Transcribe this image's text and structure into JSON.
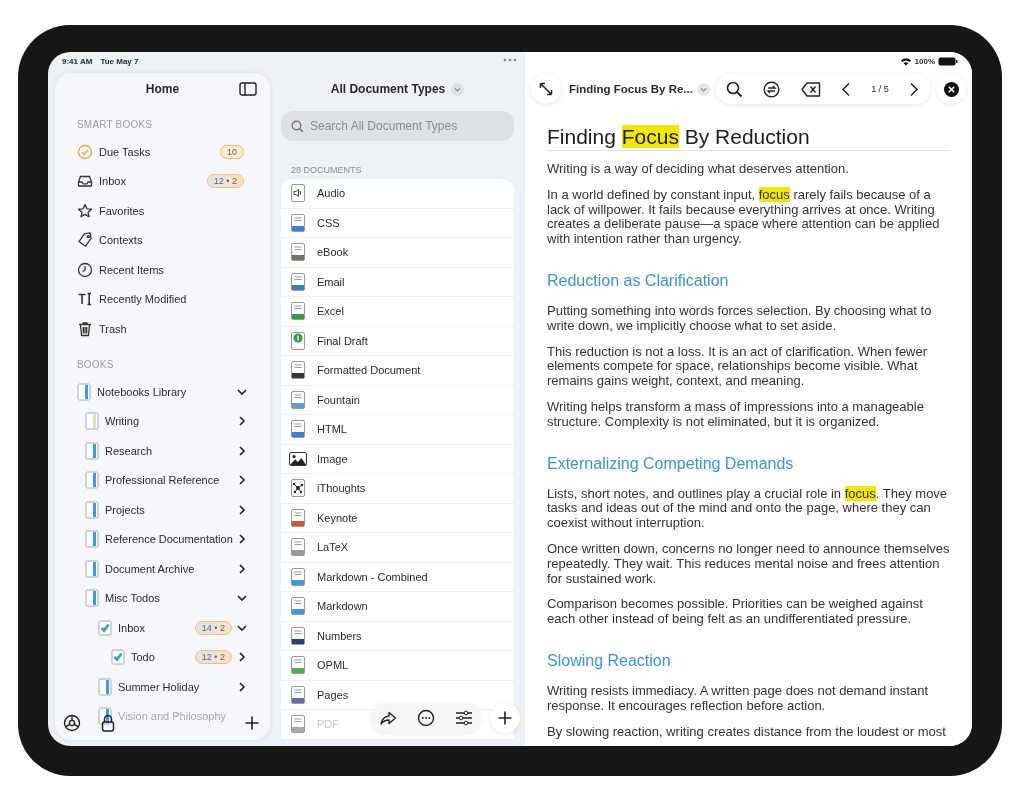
{
  "status_bar": {
    "time": "9:41 AM",
    "date": "Tue May 7",
    "battery": "100%"
  },
  "sidebar": {
    "title": "Home",
    "smart_books_label": "SMART BOOKS",
    "smart_books": [
      {
        "label": "Due Tasks",
        "kind": "check",
        "badge": {
          "text": "10",
          "kind": "due"
        }
      },
      {
        "label": "Inbox",
        "kind": "inbox",
        "badge": {
          "text": "12 • 2",
          "kind": "split"
        }
      },
      {
        "label": "Favorites",
        "kind": "star"
      },
      {
        "label": "Contexts",
        "kind": "tag"
      },
      {
        "label": "Recent Items",
        "kind": "clock"
      },
      {
        "label": "Recently Modified",
        "kind": "text"
      },
      {
        "label": "Trash",
        "kind": "trash"
      }
    ],
    "books_label": "BOOKS",
    "books": [
      {
        "label": "Notebooks Library",
        "kind": "notebook",
        "color": "#3b9be8",
        "expanded": true,
        "children": [
          {
            "label": "Writing",
            "kind": "notebook",
            "color": "#e8dcb0",
            "expanded": false
          },
          {
            "label": "Research",
            "kind": "notebook",
            "color": "#3b9be8",
            "expanded": false
          },
          {
            "label": "Professional Reference",
            "kind": "notebook",
            "color": "#3b9be8",
            "expanded": false
          },
          {
            "label": "Projects",
            "kind": "notebook",
            "color": "#3b9be8",
            "expanded": false
          },
          {
            "label": "Reference Documentation",
            "kind": "notebook",
            "color": "#3b9be8",
            "expanded": false
          },
          {
            "label": "Document Archive",
            "kind": "notebook",
            "color": "#3b9be8",
            "expanded": false
          },
          {
            "label": "Misc Todos",
            "kind": "notebook",
            "color": "#3b9be8",
            "expanded": true,
            "children": [
              {
                "label": "Inbox",
                "kind": "checklist",
                "color": "#3b9be8",
                "expanded": true,
                "badge": {
                  "text": "14 • 2",
                  "kind": "split"
                },
                "children": [
                  {
                    "label": "Todo",
                    "kind": "checklist",
                    "color": "#3b9be8",
                    "expanded": false,
                    "badge": {
                      "text": "12 • 2",
                      "kind": "split"
                    }
                  }
                ]
              },
              {
                "label": "Summer Holiday",
                "kind": "notebook",
                "color": "#3b9be8",
                "expanded": false
              },
              {
                "label": "Vision and Philosophy",
                "kind": "notebook",
                "color": "#3b9be8",
                "dimmed": true
              }
            ]
          }
        ]
      }
    ]
  },
  "document_list": {
    "title": "All Document Types",
    "search": {
      "placeholder": "Search All Document Types"
    },
    "count": "28 DOCUMENTS",
    "items": [
      {
        "label": "Audio",
        "kind": "audio"
      },
      {
        "label": "CSS",
        "kind": "doc",
        "color": "#3b82d6"
      },
      {
        "label": "eBook",
        "kind": "doc",
        "color": "#7a6f6a"
      },
      {
        "label": "Email",
        "kind": "doc",
        "color": "#3f7cc0"
      },
      {
        "label": "Excel",
        "kind": "doc",
        "color": "#3a9a4a"
      },
      {
        "label": "Final Draft",
        "kind": "draft"
      },
      {
        "label": "Formatted Document",
        "kind": "doc",
        "color": "#333333"
      },
      {
        "label": "Fountain",
        "kind": "doc",
        "color": "#5aa0d0"
      },
      {
        "label": "HTML",
        "kind": "doc",
        "color": "#3b82d6"
      },
      {
        "label": "Image",
        "kind": "image"
      },
      {
        "label": "iThoughts",
        "kind": "mindmap"
      },
      {
        "label": "Keynote",
        "kind": "doc",
        "color": "#c0602a"
      },
      {
        "label": "LaTeX",
        "kind": "doc",
        "color": "#9a9a9a"
      },
      {
        "label": "Markdown - Combined",
        "kind": "doc",
        "color": "#3b9be0"
      },
      {
        "label": "Markdown",
        "kind": "doc",
        "color": "#3b9be0"
      },
      {
        "label": "Numbers",
        "kind": "doc",
        "color": "#2c3e70"
      },
      {
        "label": "OPML",
        "kind": "doc",
        "color": "#4caf50"
      },
      {
        "label": "Pages",
        "kind": "doc",
        "color": "#6a6aa8"
      },
      {
        "label": "PDF",
        "kind": "doc",
        "color": "#aaaaaa",
        "dimmed": true
      }
    ]
  },
  "editor": {
    "title": "Finding Focus By Re...",
    "find_position": "1 / 5"
  },
  "document": {
    "title": [
      {
        "text": "Finding ",
        "highlighted": false
      },
      {
        "text": "Focus",
        "highlighted": true
      },
      {
        "text": " By Reduction",
        "highlighted": false
      }
    ],
    "blocks": [
      {
        "kind": "paragraph",
        "segments": [
          {
            "text": "Writing is a way of deciding what deserves attention.",
            "highlighted": false
          }
        ]
      },
      {
        "kind": "paragraph",
        "segments": [
          {
            "text": "In a world defined by constant input, ",
            "highlighted": false
          },
          {
            "text": "focus",
            "highlighted": true
          },
          {
            "text": " rarely fails because of a lack of willpower. It fails because everything arrives at once. Writing creates a deliberate pause—a space where attention can be applied with intention rather than urgency.",
            "highlighted": false
          }
        ]
      },
      {
        "kind": "heading",
        "segments": [
          {
            "text": "Reduction as Clarification",
            "highlighted": false
          }
        ]
      },
      {
        "kind": "paragraph",
        "segments": [
          {
            "text": "Putting something into words forces selection. By choosing what to write down, we implicitly choose what to set aside.",
            "highlighted": false
          }
        ]
      },
      {
        "kind": "paragraph",
        "segments": [
          {
            "text": "This reduction is not a loss. It is an act of clarification. When fewer elements compete for space, relationships become visible. What remains gains weight, context, and meaning.",
            "highlighted": false
          }
        ]
      },
      {
        "kind": "paragraph",
        "segments": [
          {
            "text": "Writing helps transform a mass of impressions into a manageable structure. Complexity is not eliminated, but it is organized.",
            "highlighted": false
          }
        ]
      },
      {
        "kind": "heading",
        "segments": [
          {
            "text": "Externalizing Competing Demands",
            "highlighted": false
          }
        ]
      },
      {
        "kind": "paragraph",
        "segments": [
          {
            "text": "Lists, short notes, and outlines play a crucial role in ",
            "highlighted": false
          },
          {
            "text": "focus",
            "highlighted": true
          },
          {
            "text": ". They move tasks and ideas out of the mind and onto the page, where they can coexist without interruption.",
            "highlighted": false
          }
        ]
      },
      {
        "kind": "paragraph",
        "segments": [
          {
            "text": "Once written down, concerns no longer need to announce themselves repeatedly. They wait. This reduces mental noise and frees attention for sustained work.",
            "highlighted": false
          }
        ]
      },
      {
        "kind": "paragraph",
        "segments": [
          {
            "text": "Comparison becomes possible. Priorities can be weighed against each other instead of being felt as an undifferentiated pressure.",
            "highlighted": false
          }
        ]
      },
      {
        "kind": "heading",
        "segments": [
          {
            "text": "Slowing Reaction",
            "highlighted": false
          }
        ]
      },
      {
        "kind": "paragraph",
        "segments": [
          {
            "text": "Writing resists immediacy. A written page does not demand instant response. It encourages reflection before action.",
            "highlighted": false
          }
        ]
      },
      {
        "kind": "paragraph",
        "segments": [
          {
            "text": "By slowing reaction, writing creates distance from the loudest or most",
            "highlighted": false
          }
        ]
      }
    ]
  }
}
